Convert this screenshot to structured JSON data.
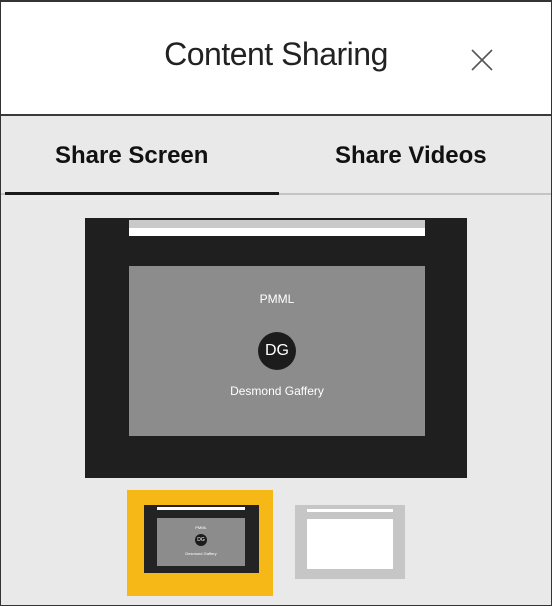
{
  "header": {
    "title": "Content Sharing",
    "close_icon": "close-icon"
  },
  "tabs": [
    {
      "label": "Share Screen",
      "selected": true
    },
    {
      "label": "Share Videos",
      "selected": false
    }
  ],
  "preview": {
    "meeting_name": "PMML",
    "avatar_initials": "DG",
    "participant_name": "Desmond Gaffery"
  },
  "thumbnails": [
    {
      "meeting_name": "PMML",
      "avatar_initials": "DG",
      "participant_name": "Desmond Gaffery",
      "selected": true
    },
    {
      "selected": false
    }
  ],
  "colors": {
    "selection_accent": "#f6b817",
    "screen_gray": "#8c8c8c",
    "frame_dark": "#1f1f1f",
    "panel_background": "#e9e9e9"
  }
}
